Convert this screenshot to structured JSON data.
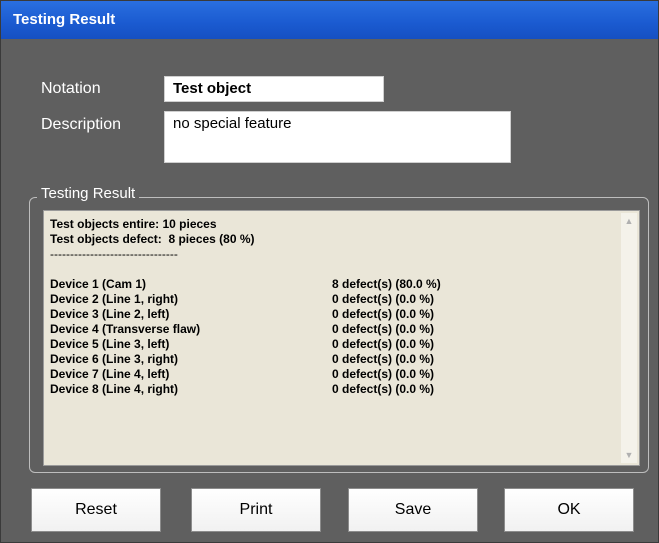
{
  "window": {
    "title": "Testing Result"
  },
  "form": {
    "notation_label": "Notation",
    "notation_value": "Test object",
    "description_label": "Description",
    "description_value": "no special feature"
  },
  "result": {
    "group_title": "Testing Result",
    "summary": [
      "Test objects entire: 10 pieces",
      "Test objects defect:  8 pieces (80 %)"
    ],
    "separator": "--------------------------------",
    "devices": [
      {
        "name": "Device 1 (Cam 1)",
        "value": "8 defect(s) (80.0 %)"
      },
      {
        "name": "Device 2 (Line 1, right)",
        "value": "0 defect(s) (0.0 %)"
      },
      {
        "name": "Device 3 (Line 2, left)",
        "value": "0 defect(s) (0.0 %)"
      },
      {
        "name": "Device 4 (Transverse flaw)",
        "value": "0 defect(s) (0.0 %)"
      },
      {
        "name": "Device 5 (Line 3, left)",
        "value": "0 defect(s) (0.0 %)"
      },
      {
        "name": "Device 6 (Line 3, right)",
        "value": "0 defect(s) (0.0 %)"
      },
      {
        "name": "Device 7 (Line 4, left)",
        "value": "0 defect(s) (0.0 %)"
      },
      {
        "name": "Device 8 (Line 4, right)",
        "value": "0 defect(s) (0.0 %)"
      }
    ]
  },
  "buttons": {
    "reset": "Reset",
    "print": "Print",
    "save": "Save",
    "ok": "OK"
  },
  "icons": {
    "scroll_up": "scroll-up-arrow-icon",
    "scroll_down": "scroll-down-arrow-icon"
  }
}
